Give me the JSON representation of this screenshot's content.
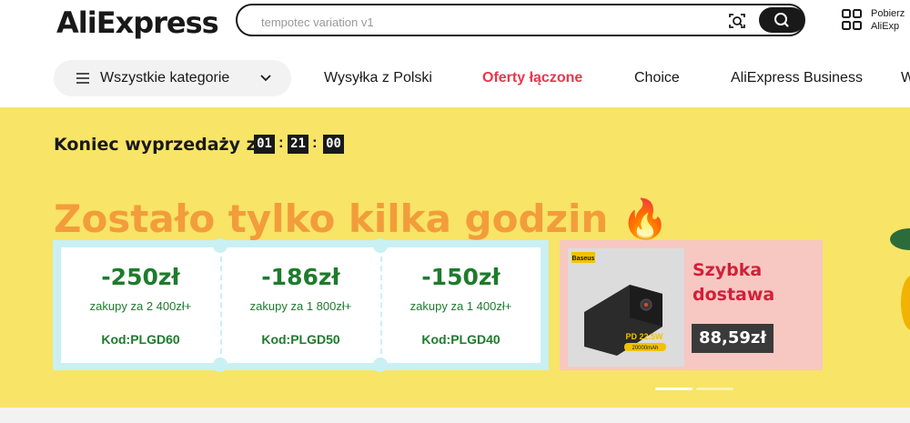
{
  "header": {
    "logo": "AliExpress",
    "search": {
      "value": "",
      "placeholder": "tempotec variation v1"
    },
    "app_promo": {
      "line1": "Pobierz",
      "line2": "AliExp"
    }
  },
  "nav": {
    "categories_label": "Wszystkie kategorie",
    "links": [
      "Wysyłka z Polski",
      "Oferty łączone",
      "Choice",
      "AliExpress Business",
      "W"
    ]
  },
  "banner": {
    "timer_label": "Koniec wyprzedaży za:",
    "timer": {
      "hours": "01",
      "minutes": "21",
      "seconds": "00"
    },
    "headline": "Zostało tylko kilka godzin 🔥",
    "coupons": [
      {
        "amount": "-250zł",
        "condition": "zakupy za 2 400zł+",
        "code": "Kod:PLGD60"
      },
      {
        "amount": "-186zł",
        "condition": "zakupy za 1 800zł+",
        "code": "Kod:PLGD50"
      },
      {
        "amount": "-150zł",
        "condition": "zakupy za 1 400zł+",
        "code": "Kod:PLGD40"
      }
    ],
    "promo": {
      "title_line1": "Szybka",
      "title_line2": "dostawa",
      "price": "88,59zł",
      "product_brand": "Baseus",
      "product_spec1": "PD 22.5W",
      "product_spec2": "20000mAh"
    },
    "carousel": {
      "active_index": 0,
      "count": 2
    }
  },
  "colors": {
    "banner_bg": "#f8e466",
    "coupon_green": "#1e7b2c",
    "coupon_frame": "#c9f0f3",
    "promo_bg": "#f7c8c1",
    "promo_red": "#d2203a",
    "nav_hot": "#e8374e"
  },
  "icons": {
    "search": "search-icon",
    "camera": "camera-search-icon",
    "qr": "qr-code-icon",
    "menu": "hamburger-icon",
    "chevron": "chevron-down-icon"
  }
}
